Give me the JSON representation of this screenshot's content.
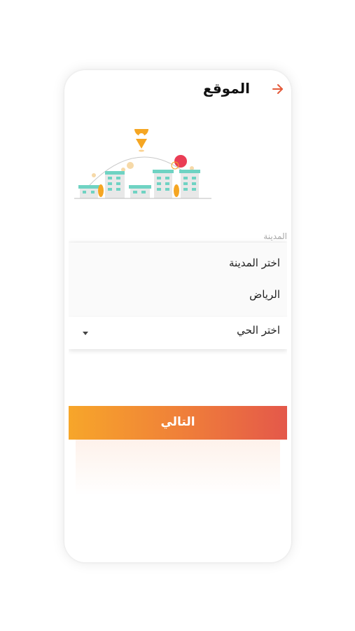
{
  "header": {
    "title": "الموقع",
    "back_icon": "arrow-right-icon"
  },
  "form": {
    "city_label": "المدينة",
    "city_options": [
      "اختر المدينة",
      "الرياض"
    ],
    "district_placeholder": "اختر الحي"
  },
  "actions": {
    "next_label": "التالي"
  },
  "colors": {
    "accent": "#e45a3a",
    "button_start": "#f7a62a",
    "button_end": "#e4584a",
    "building_teal": "#6fd3c3",
    "pin_orange": "#f5a623",
    "sun_red": "#ea3d55"
  }
}
